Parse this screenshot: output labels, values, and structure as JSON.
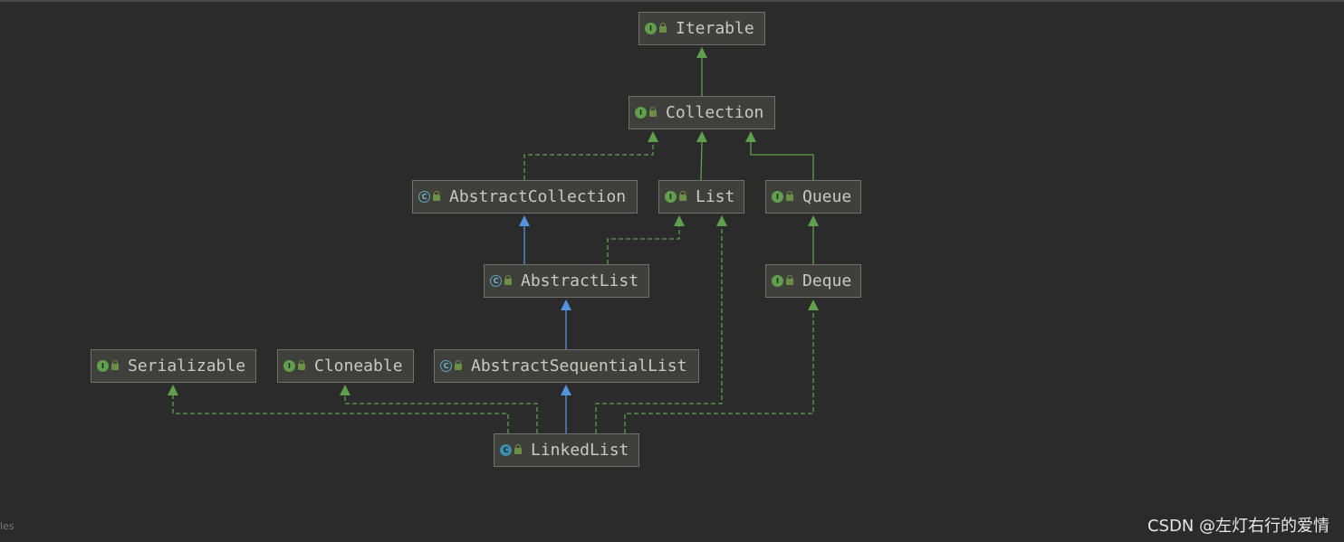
{
  "diagram": {
    "nodes": [
      {
        "id": "iterable",
        "label": "Iterable",
        "kind": "interface"
      },
      {
        "id": "collection",
        "label": "Collection",
        "kind": "interface"
      },
      {
        "id": "abstract_collection",
        "label": "AbstractCollection",
        "kind": "abstract"
      },
      {
        "id": "list",
        "label": "List",
        "kind": "interface"
      },
      {
        "id": "queue",
        "label": "Queue",
        "kind": "interface"
      },
      {
        "id": "abstract_list",
        "label": "AbstractList",
        "kind": "abstract"
      },
      {
        "id": "deque",
        "label": "Deque",
        "kind": "interface"
      },
      {
        "id": "serializable",
        "label": "Serializable",
        "kind": "interface"
      },
      {
        "id": "cloneable",
        "label": "Cloneable",
        "kind": "interface"
      },
      {
        "id": "abstract_sequential_list",
        "label": "AbstractSequentialList",
        "kind": "abstract"
      },
      {
        "id": "linked_list",
        "label": "LinkedList",
        "kind": "class"
      }
    ],
    "edges": [
      {
        "from": "collection",
        "to": "iterable",
        "type": "extends-interface"
      },
      {
        "from": "abstract_collection",
        "to": "collection",
        "type": "implements"
      },
      {
        "from": "list",
        "to": "collection",
        "type": "extends-interface"
      },
      {
        "from": "queue",
        "to": "collection",
        "type": "extends-interface"
      },
      {
        "from": "abstract_list",
        "to": "abstract_collection",
        "type": "extends-class"
      },
      {
        "from": "abstract_list",
        "to": "list",
        "type": "implements"
      },
      {
        "from": "deque",
        "to": "queue",
        "type": "extends-interface"
      },
      {
        "from": "abstract_sequential_list",
        "to": "abstract_list",
        "type": "extends-class"
      },
      {
        "from": "linked_list",
        "to": "abstract_sequential_list",
        "type": "extends-class"
      },
      {
        "from": "linked_list",
        "to": "serializable",
        "type": "implements"
      },
      {
        "from": "linked_list",
        "to": "cloneable",
        "type": "implements"
      },
      {
        "from": "linked_list",
        "to": "list",
        "type": "implements"
      },
      {
        "from": "linked_list",
        "to": "deque",
        "type": "implements"
      }
    ],
    "colors": {
      "background": "#2b2b2b",
      "node_fill": "#3f403b",
      "node_border": "#6f716b",
      "interface_edge": "#5f9f4d",
      "class_edge": "#5592e0"
    }
  },
  "footer": {
    "corner_text": "les",
    "watermark": "CSDN @左灯右行的爱情"
  }
}
